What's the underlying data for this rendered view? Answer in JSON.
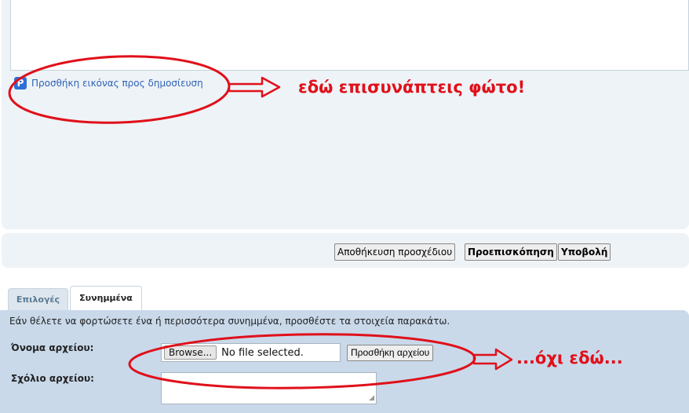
{
  "editor": {
    "add_photo_label": "Προσθήκη εικόνας προς δημοσίευση",
    "photo_icon": "photo-upload-icon"
  },
  "annotations": {
    "here_attach": "εδώ επισυνάπτεις φώτο!",
    "not_here": "...όχι εδώ..."
  },
  "actions": {
    "save_draft": "Αποθήκευση προσχέδιου",
    "preview": "Προεπισκόπηση",
    "submit": "Υποβολή"
  },
  "tabs": [
    {
      "label": "Επιλογές",
      "active": false
    },
    {
      "label": "Συνημμένα",
      "active": true
    }
  ],
  "attachments": {
    "help_text": "Εάν θέλετε να φορτώσετε ένα ή περισσότερα συνημμένα, προσθέστε τα στοιχεία παρακάτω.",
    "filename_label": "Όνομα αρχείου:",
    "comment_label": "Σχόλιο αρχείου:",
    "browse_label": "Browse...",
    "file_status": "No file selected.",
    "add_file_label": "Προσθήκη αρχείου"
  },
  "colors": {
    "annotation_red": "#e0101a",
    "panel_bg": "#eef3f7",
    "attach_bg": "#c9d9ea",
    "link_blue": "#2f62b5"
  }
}
